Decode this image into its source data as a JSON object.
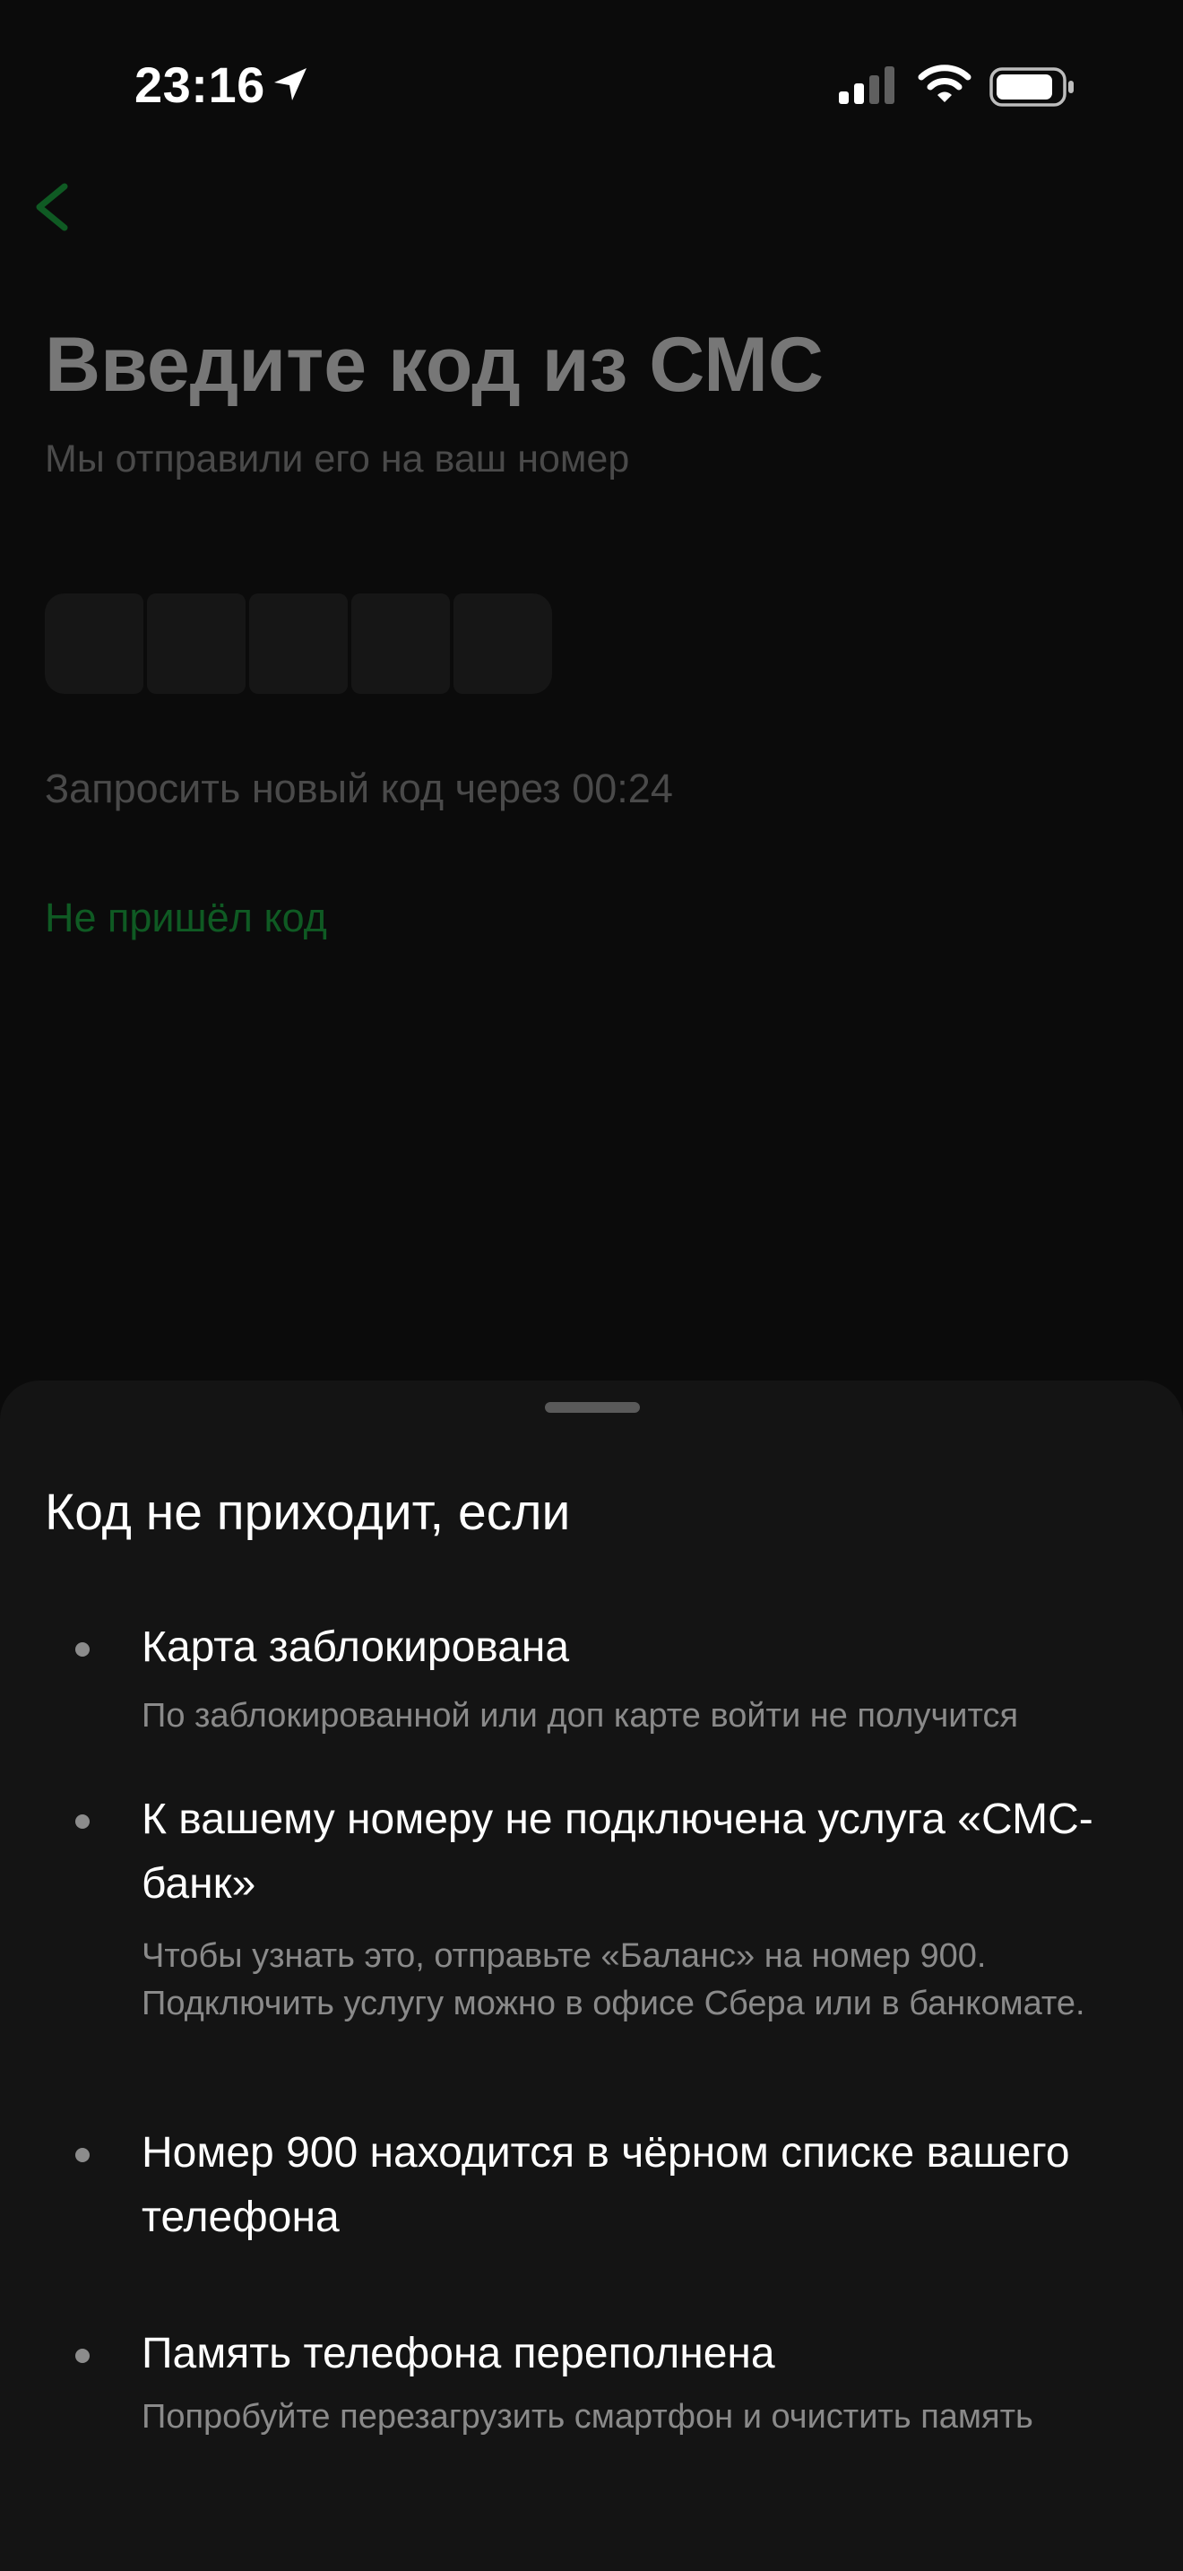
{
  "status_bar": {
    "time": "23:16"
  },
  "icons": {
    "location": "location-arrow-icon",
    "signal": "cellular-signal-icon",
    "wifi": "wifi-icon",
    "battery": "battery-icon",
    "back": "chevron-left-icon"
  },
  "colors": {
    "background": "#0b0b0b",
    "sheet_background": "#141414",
    "accent_green": "#0f5a23",
    "text_primary": "#ffffff",
    "text_secondary": "#8a8a8a"
  },
  "page": {
    "title": "Введите код из СМС",
    "subtitle": "Мы отправили его на ваш номер",
    "code_length": 5,
    "resend_timer": "Запросить новый код через 00:24",
    "no_code_link": "Не пришёл код"
  },
  "sheet": {
    "title": "Код не приходит, если",
    "reasons": [
      {
        "title": "Карта заблокирована",
        "description": "По заблокированной или доп карте войти не получится"
      },
      {
        "title": "К вашему номеру не подключена услуга «СМС-банк»",
        "description": "Чтобы узнать это, отправьте «Баланс» на номер 900. Подключить услугу можно в офисе Сбера или в банкомате."
      },
      {
        "title": "Номер 900 находится в чёрном списке вашего телефона",
        "description": ""
      },
      {
        "title": "Память телефона переполнена",
        "description": "Попробуйте перезагрузить смартфон и очистить память"
      }
    ]
  }
}
